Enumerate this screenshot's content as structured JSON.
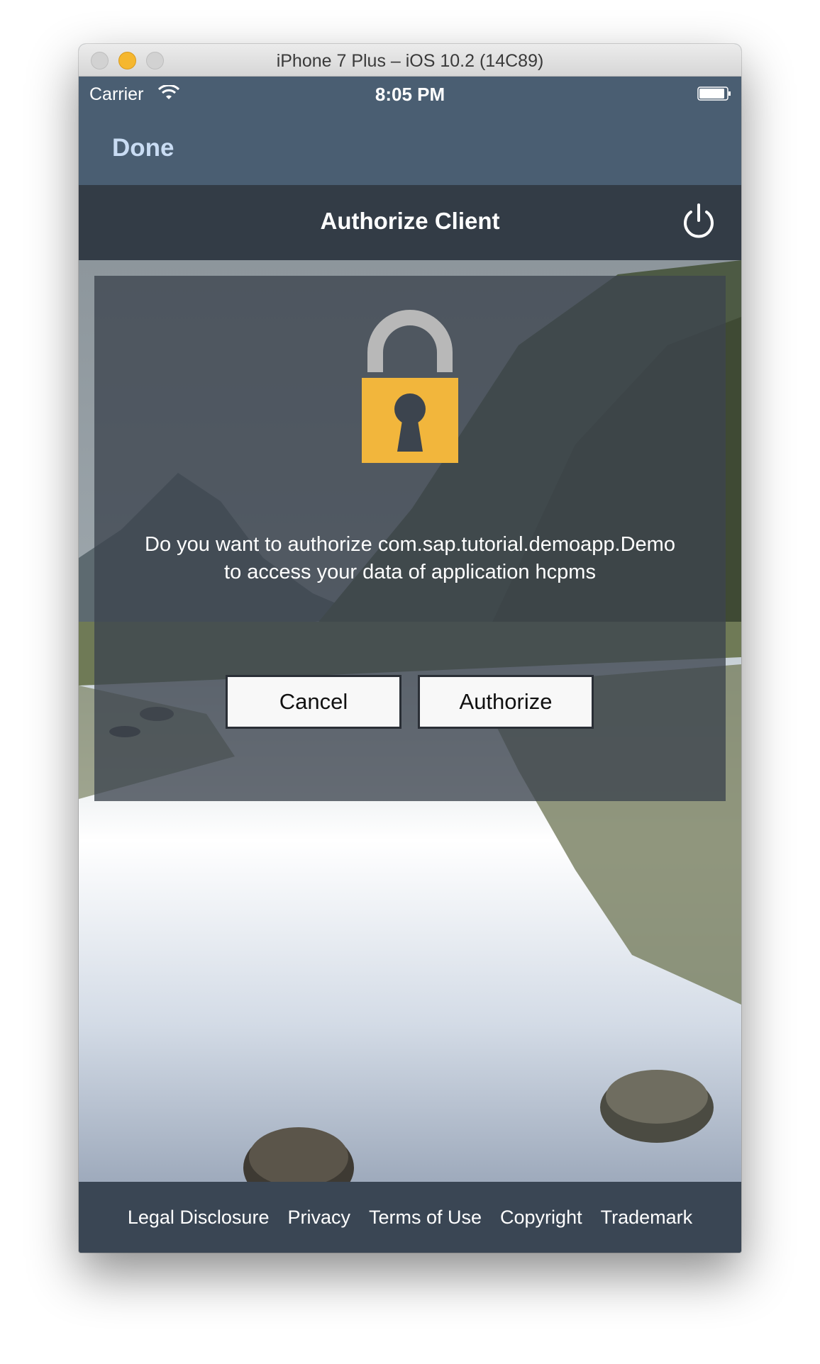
{
  "window": {
    "title": "iPhone 7 Plus – iOS 10.2 (14C89)"
  },
  "status_bar": {
    "carrier": "Carrier",
    "time": "8:05 PM"
  },
  "nav": {
    "done_label": "Done"
  },
  "header": {
    "title": "Authorize Client"
  },
  "dialog": {
    "message_line1": "Do you want to authorize com.sap.tutorial.demoapp.Demo",
    "message_line2": "to access your data of application hcpms",
    "cancel_label": "Cancel",
    "authorize_label": "Authorize"
  },
  "footer": {
    "links": [
      "Legal Disclosure",
      "Privacy",
      "Terms of Use",
      "Copyright",
      "Trademark"
    ]
  },
  "colors": {
    "nav_bg": "#4a5e72",
    "header_bg": "#333c46",
    "lock_body": "#f2b63c",
    "lock_shackle": "#b8b8b8",
    "done_text": "#c9dcf3"
  },
  "icons": [
    "wifi-icon",
    "battery-icon",
    "power-icon",
    "lock-icon"
  ]
}
